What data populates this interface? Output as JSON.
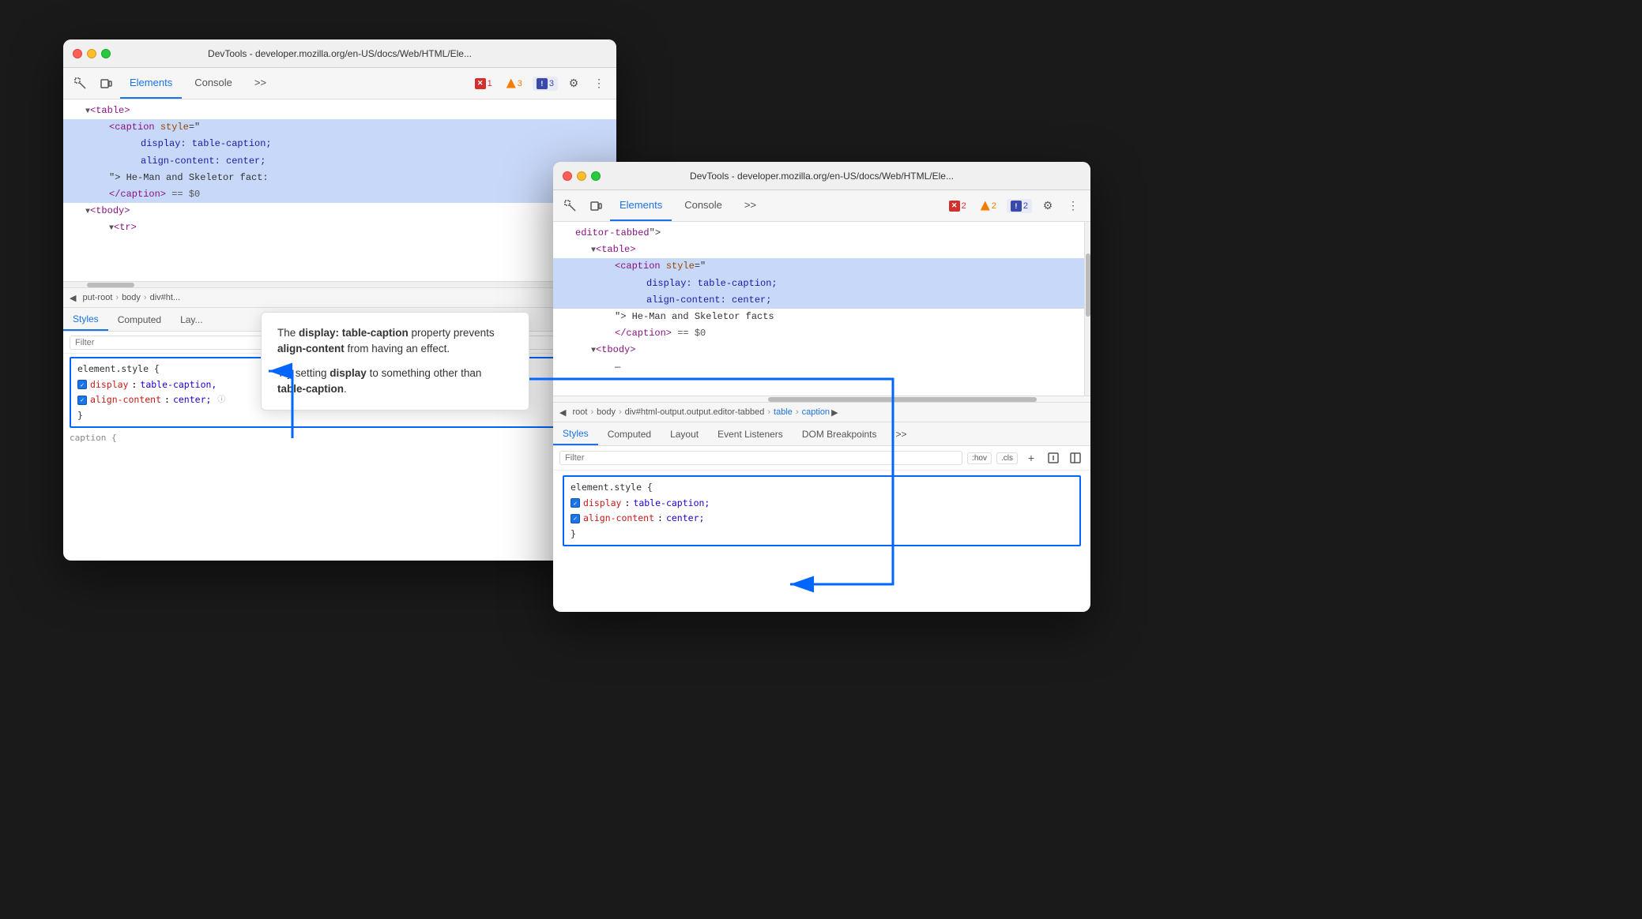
{
  "window1": {
    "title": "DevTools - developer.mozilla.org/en-US/docs/Web/HTML/Ele...",
    "tabs": {
      "elements": "Elements",
      "console": "Console",
      "more": ">>"
    },
    "badges": {
      "error": {
        "icon": "✕",
        "count": "1"
      },
      "warning": {
        "icon": "▲",
        "count": "3"
      },
      "info": {
        "icon": "!",
        "count": "3"
      }
    },
    "html": [
      {
        "indent": 0,
        "content": "▼<table>",
        "selected": false
      },
      {
        "indent": 1,
        "content": "<caption style=\"",
        "selected": true
      },
      {
        "indent": 2,
        "content": "display: table-caption;",
        "selected": true
      },
      {
        "indent": 2,
        "content": "align-content: center;",
        "selected": true
      },
      {
        "indent": 1,
        "content": "\"> He-Man and Skeletor fact:",
        "selected": true
      },
      {
        "indent": 1,
        "content": "</caption> == $0",
        "selected": true
      },
      {
        "indent": 0,
        "content": "▼<tbody>",
        "selected": false
      },
      {
        "indent": 1,
        "content": "▼<tr>",
        "selected": false
      }
    ],
    "breadcrumb": [
      "◀",
      "put-root",
      "body",
      "div#ht..."
    ],
    "stylesTabs": [
      "Styles",
      "Computed",
      "Lay..."
    ],
    "filter": "Filter",
    "cssBlock": {
      "selector": "element.style {",
      "props": [
        {
          "name": "display",
          "value": "table-caption,"
        },
        {
          "name": "align-content",
          "value": "center;"
        }
      ],
      "close": "}"
    },
    "captionRule": "caption {"
  },
  "window2": {
    "title": "DevTools - developer.mozilla.org/en-US/docs/Web/HTML/Ele...",
    "tabs": {
      "elements": "Elements",
      "console": "Console",
      "more": ">>"
    },
    "badges": {
      "error": {
        "icon": "✕",
        "count": "2"
      },
      "warning": {
        "icon": "▲",
        "count": "2"
      },
      "info": {
        "icon": "!",
        "count": "2"
      }
    },
    "html": [
      {
        "indent": 0,
        "content": "editor-tabbed\">",
        "selected": false
      },
      {
        "indent": 1,
        "content": "▼<table>",
        "selected": false
      },
      {
        "indent": 2,
        "content": "<caption style=\"",
        "selected": true
      },
      {
        "indent": 3,
        "content": "display: table-caption;",
        "selected": true
      },
      {
        "indent": 3,
        "content": "align-content: center;",
        "selected": true
      },
      {
        "indent": 2,
        "content": "\"> He-Man and Skeletor facts",
        "selected": false
      },
      {
        "indent": 2,
        "content": "</caption> == $0",
        "selected": false
      },
      {
        "indent": 1,
        "content": "▼<tbody>",
        "selected": false
      },
      {
        "indent": 2,
        "content": "—",
        "selected": false
      }
    ],
    "breadcrumb": [
      "◀",
      "root",
      "body",
      "div#html-output.output.editor-tabbed",
      "table",
      "caption",
      "▶"
    ],
    "stylesTabs": [
      "Styles",
      "Computed",
      "Layout",
      "Event Listeners",
      "DOM Breakpoints",
      ">>"
    ],
    "filter": "Filter",
    "pseudoBtns": [
      ":hov",
      ".cls"
    ],
    "filterIcons": [
      "+",
      "□",
      "◧"
    ],
    "cssBlock": {
      "selector": "element.style {",
      "props": [
        {
          "name": "display",
          "value": "table-caption;"
        },
        {
          "name": "align-content",
          "value": "center;"
        }
      ],
      "close": "}"
    }
  },
  "tooltip": {
    "line1_prefix": "The ",
    "line1_bold1": "display: table-caption",
    "line1_suffix": " property",
    "line2": "prevents ",
    "line2_bold": "align-content",
    "line2_suffix": " from having an",
    "line3": "effect.",
    "line4": "Try setting ",
    "line4_bold": "display",
    "line4_suffix": " to something other than",
    "line5_bold": "table-caption",
    "line5_suffix": "."
  }
}
